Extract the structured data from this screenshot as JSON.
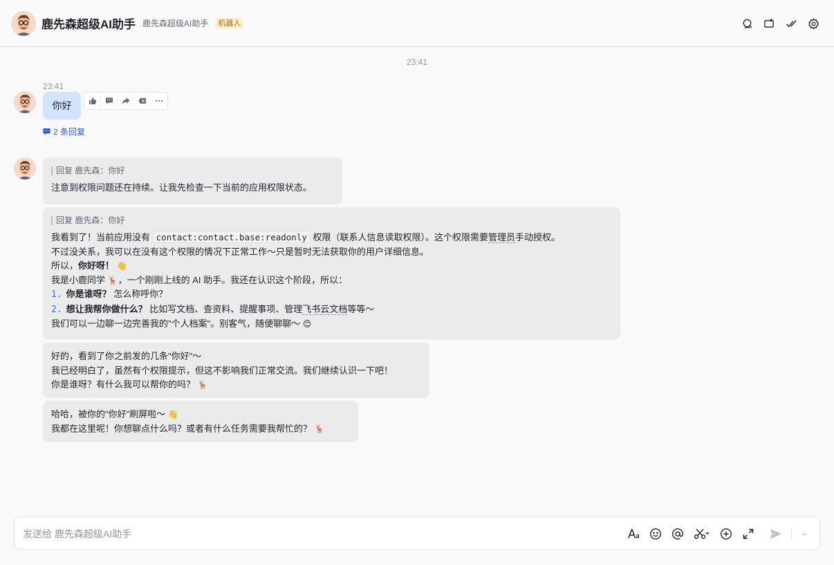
{
  "header": {
    "title": "鹿先森超级AI助手",
    "subtitle": "鹿先森超级AI助手",
    "badge": "机器人",
    "icons": [
      "search-icon",
      "add-tab-icon",
      "done-icon",
      "settings-icon"
    ]
  },
  "center_time": "23:41",
  "user_message": {
    "time": "23:41",
    "text": "你好",
    "reply_count": "2 条回复",
    "actions": [
      "thumbs-up-icon",
      "comment-icon",
      "forward-icon",
      "reply-icon",
      "more-icon"
    ]
  },
  "bot_messages": {
    "m1": {
      "quote": "回复 鹿先森：你好",
      "text": "注意到权限问题还在持续。让我先检查一下当前的应用权限状态。"
    },
    "m2": {
      "quote": "回复 鹿先森：你好",
      "l1_pre": "我看到了！当前应用没有",
      "l1_code": "contact:contact.base:readonly",
      "l1_post": "权限（联系人信息读取权限）。这个权限需要",
      "l1_link": "管理员",
      "l1_end": "手动授权。",
      "l2": "不过没关系，我可以在没有这个权限的情况下正常工作～只是暂时无法获取你的用户详细信息。",
      "l3_pre": "所以，",
      "l3_bold": "你好呀！",
      "l3_emoji": "👋",
      "l4_pre": "我是小鹿同学",
      "l4_emoji": "🦌",
      "l4_post": "，一个刚刚上线的 AI 助手。我还在认识这个阶段，所以：",
      "i1_num": "1.",
      "i1_bold": "你是谁呀？",
      "i1_text": "怎么称呼你？",
      "i2_num": "2.",
      "i2_bold": "想让我帮你做什么？",
      "i2_pre": "比如写文档、查资料、提醒事项、管理",
      "i2_link": "飞书云文档",
      "i2_post": "等等～",
      "l7_text": "我们可以一边聊一边完善我的\"个人档案\"。别客气，随便聊聊～",
      "l7_emoji": "😊"
    },
    "m3": {
      "l1": "好的，看到了你之前发的几条\"你好\"～",
      "l2": "我已经明白了，虽然有个权限提示，但这不影响我们正常交流。我们继续认识一下吧！",
      "l3_text": "你是谁呀？有什么我可以帮你的吗？",
      "l3_emoji": "🦌"
    },
    "m4": {
      "l1_text": "哈哈，被你的\"你好\"刷屏啦～",
      "l1_emoji": "👋",
      "l2_text": "我都在这里呢！你想聊点什么吗？或者有什么任务需要我帮忙的？",
      "l2_emoji": "🦌"
    }
  },
  "input": {
    "placeholder": "发送给 鹿先森超级AI助手",
    "tools": [
      "font-icon",
      "emoji-icon",
      "mention-icon",
      "scissors-icon",
      "add-icon",
      "expand-icon",
      "send-icon",
      "chevron-down-icon"
    ]
  },
  "colors": {
    "accent": "#245bdb",
    "user_bubble": "#d1e3ff",
    "bot_bubble": "#ebebeb",
    "badge_bg": "#fdf0d2",
    "badge_text": "#a66e00"
  }
}
